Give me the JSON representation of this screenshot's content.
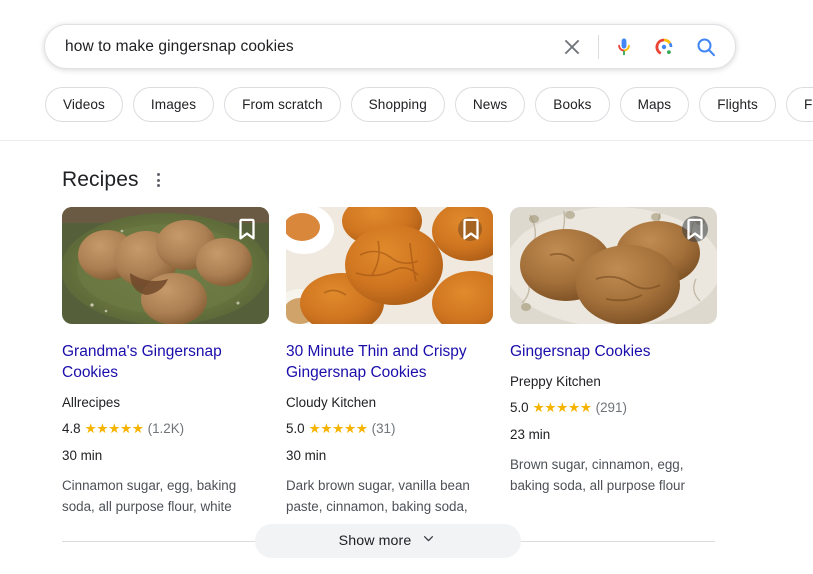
{
  "search": {
    "query": "how to make gingersnap cookies",
    "placeholder": "Search",
    "clear_label": "Clear",
    "mic_label": "Search by voice",
    "lens_label": "Search by image",
    "submit_label": "Google Search"
  },
  "filters": {
    "chips": [
      {
        "label": "Videos"
      },
      {
        "label": "Images"
      },
      {
        "label": "From scratch"
      },
      {
        "label": "Shopping"
      },
      {
        "label": "News"
      },
      {
        "label": "Books"
      },
      {
        "label": "Maps"
      },
      {
        "label": "Flights"
      },
      {
        "label": "Finance"
      }
    ]
  },
  "recipes_section": {
    "title": "Recipes",
    "menu_label": "About this result",
    "cards": [
      {
        "title": "Grandma's Gingersnap Cookies",
        "source": "Allrecipes",
        "rating": "4.8",
        "stars": "★★★★★",
        "review_count": "(1.2K)",
        "time": "30 min",
        "description": "Cinnamon sugar, egg, baking soda, all purpose flour, white",
        "bookmark_label": "Save",
        "image_alt": "Gingersnap cookies on a dark green plate"
      },
      {
        "title": "30 Minute Thin and Crispy Gingersnap Cookies",
        "source": "Cloudy Kitchen",
        "rating": "5.0",
        "stars": "★★★★★",
        "review_count": "(31)",
        "time": "30 min",
        "description": "Dark brown sugar, vanilla bean paste, cinnamon, baking soda,",
        "bookmark_label": "Save",
        "image_alt": "Crackled orange gingersnap cookies on parchment paper"
      },
      {
        "title": "Gingersnap Cookies",
        "source": "Preppy Kitchen",
        "rating": "5.0",
        "stars": "★★★★★",
        "review_count": "(291)",
        "time": "23 min",
        "description": "Brown sugar, cinnamon, egg, baking soda, all purpose flour",
        "bookmark_label": "Save",
        "image_alt": "Gingersnap cookies stacked on a patterned white plate"
      }
    ],
    "show_more_label": "Show more"
  },
  "colors": {
    "link": "#1a0dab",
    "star": "#f5b400",
    "text": "#202124",
    "muted": "#70757a",
    "chip_border": "#dadce0",
    "chip_bg": "#f1f3f4"
  }
}
